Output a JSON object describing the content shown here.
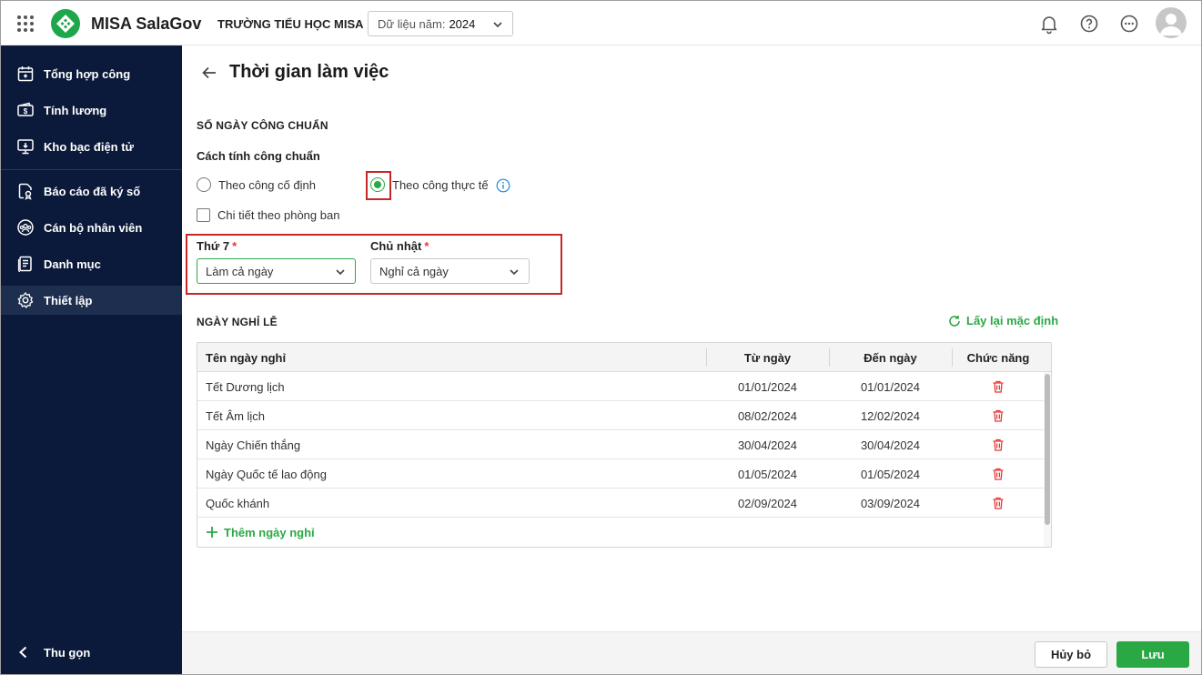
{
  "header": {
    "app_name": "MISA SalaGov",
    "org_name": "TRƯỜNG TIỂU HỌC MISA",
    "year_select": {
      "label": "Dữ liệu năm:",
      "value": "2024"
    },
    "icons": [
      "grid-apps-icon",
      "bell-icon",
      "help-icon",
      "more-icon",
      "user-avatar-icon"
    ]
  },
  "sidebar": {
    "items": [
      {
        "label": "Tổng hợp công",
        "icon": "calendar-icon"
      },
      {
        "label": "Tính lương",
        "icon": "wallet-icon"
      },
      {
        "label": "Kho bạc điện tử",
        "icon": "monitor-icon"
      },
      {
        "label": "Báo cáo đã ký số",
        "icon": "signed-report-icon"
      },
      {
        "label": "Cán bộ nhân viên",
        "icon": "staff-icon"
      },
      {
        "label": "Danh mục",
        "icon": "list-icon"
      },
      {
        "label": "Thiết lập",
        "icon": "gear-icon",
        "active": true
      }
    ],
    "collapse_label": "Thu gọn"
  },
  "main": {
    "title": "Thời gian làm việc",
    "standard_days": {
      "section_title": "SỐ NGÀY CÔNG CHUẨN",
      "method_label": "Cách tính công chuẩn",
      "options": [
        {
          "label": "Theo công cố định",
          "checked": false
        },
        {
          "label": "Theo công thực tế",
          "checked": true
        }
      ],
      "detail_checkbox": {
        "label": "Chi tiết theo phòng ban",
        "checked": false
      },
      "saturday": {
        "label": "Thứ 7",
        "required_mark": "*",
        "value": "Làm cả ngày"
      },
      "sunday": {
        "label": "Chủ nhật",
        "required_mark": "*",
        "value": "Nghỉ cả ngày"
      }
    },
    "holidays": {
      "section_title": "NGÀY NGHỈ LỄ",
      "reset_label": "Lấy lại mặc định",
      "columns": [
        "Tên ngày nghỉ",
        "Từ ngày",
        "Đến ngày",
        "Chức năng"
      ],
      "rows": [
        {
          "name": "Tết Dương lịch",
          "from": "01/01/2024",
          "to": "01/01/2024"
        },
        {
          "name": "Tết Âm lịch",
          "from": "08/02/2024",
          "to": "12/02/2024"
        },
        {
          "name": "Ngày Chiến thắng",
          "from": "30/04/2024",
          "to": "30/04/2024"
        },
        {
          "name": "Ngày Quốc tế lao động",
          "from": "01/05/2024",
          "to": "01/05/2024"
        },
        {
          "name": "Quốc khánh",
          "from": "02/09/2024",
          "to": "03/09/2024"
        }
      ],
      "add_label": "Thêm ngày nghỉ"
    }
  },
  "footer": {
    "cancel_label": "Hủy bỏ",
    "save_label": "Lưu"
  },
  "colors": {
    "accent": "#2aa844",
    "sidebar_bg": "#0b1a3a",
    "highlight": "#c62828",
    "danger": "#e53935"
  }
}
